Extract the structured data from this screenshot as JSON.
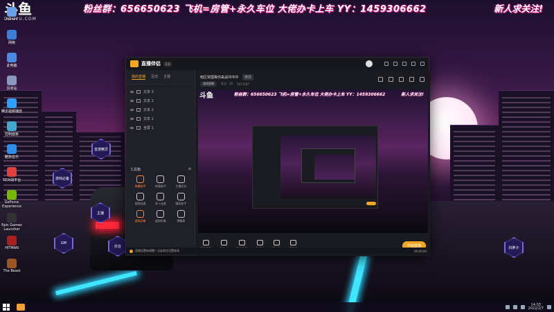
{
  "banner": {
    "text": "粉丝群：656650623 飞机=房管+永久车位 大佬办卡上车 YY：1459306662",
    "right_text": "新人求关注!"
  },
  "douyu": {
    "logo": "斗鱼",
    "sub": "DOUYU.COM"
  },
  "desktop_icons": [
    {
      "label": "Admini",
      "color": "#6aa0e8"
    },
    {
      "label": "网络",
      "color": "#3c7fd6"
    },
    {
      "label": "此电脑",
      "color": "#4a8ae0"
    },
    {
      "label": "回收站",
      "color": "#8899bb"
    },
    {
      "label": "腾讯视频播放",
      "color": "#2ea0ff"
    },
    {
      "label": "控制面板",
      "color": "#44aacc"
    },
    {
      "label": "酷狗音乐",
      "color": "#2d8fe8"
    },
    {
      "label": "5E对战平台",
      "color": "#e04040"
    },
    {
      "label": "GeForce Experience",
      "color": "#76b900"
    },
    {
      "label": "Epic Games Launcher",
      "color": "#333333"
    },
    {
      "label": "HITMAN",
      "color": "#aa2020"
    },
    {
      "label": "The Beast",
      "color": "#995522"
    }
  ],
  "hex_buttons": [
    "音游精灵",
    "游戏必备",
    "主播",
    "抖音",
    "GM",
    "欢迎",
    "抖胖子"
  ],
  "app": {
    "name": "直播伴侣",
    "version": "2.0",
    "left_tabs": [
      "我的直播",
      "互动",
      "主播"
    ],
    "scenes": [
      "文本 3",
      "文本 2",
      "文本 2",
      "文本 1",
      "全屏 1"
    ],
    "tools_title": "工具箱",
    "tools": [
      {
        "label": "弹幕助手",
        "hl": true
      },
      {
        "label": "房管助手",
        "hl": false
      },
      {
        "label": "主播任务",
        "hl": false
      },
      {
        "label": "视频连麦",
        "hl": false
      },
      {
        "label": "多人连麦",
        "hl": false
      },
      {
        "label": "精彩助手",
        "hl": false
      },
      {
        "label": "虚拟形象",
        "hl": true
      },
      {
        "label": "虚拟形象",
        "hl": false
      },
      {
        "label": "弹幕姬",
        "hl": false
      }
    ],
    "room_title": "暗区突围等你来战冲冲冲",
    "room_btn": "修改",
    "room_meta": {
      "category": "游戏直播",
      "followers": "关注：30",
      "audience": "5671587"
    },
    "bottom_items": [
      "直播屏幕",
      "摄像头",
      "手机投屏",
      "多媒体",
      "麦克风",
      "扬声器"
    ],
    "start_live": "开始直播",
    "status_text": "直播设置有调整？点此前往设置修改",
    "status_time": "00:00:00"
  },
  "taskbar": {
    "time": "14:03",
    "date": "2022/2/7"
  }
}
